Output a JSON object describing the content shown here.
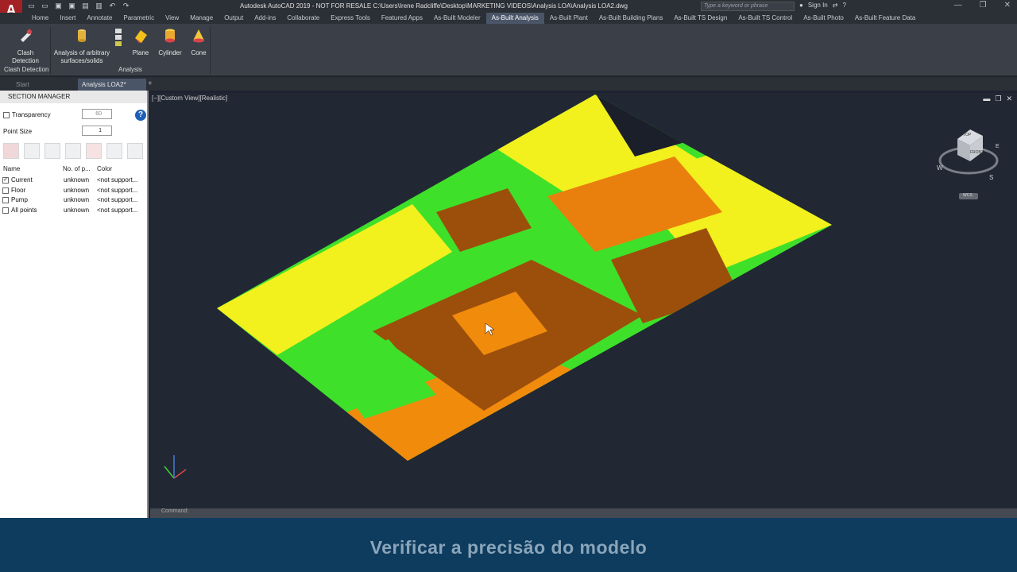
{
  "app": {
    "logo": "A",
    "title": "Autodesk AutoCAD 2019 - NOT FOR RESALE   C:\\Users\\Irene Radcliffe\\Desktop\\MARKETING VIDEOS\\Analysis LOA\\Analysis LOA2.dwg",
    "search_placeholder": "Type a keyword or phrase",
    "sign_in": "Sign In"
  },
  "menu_tabs": [
    "Home",
    "Insert",
    "Annotate",
    "Parametric",
    "View",
    "Manage",
    "Output",
    "Add-ins",
    "Collaborate",
    "Express Tools",
    "Featured Apps",
    "As-Built Modeler",
    "As-Built Analysis",
    "As-Built Plant",
    "As-Built Building Plans",
    "As-Built TS Design",
    "As-Built TS Control",
    "As-Built Photo",
    "As-Built Feature Data"
  ],
  "active_tab": "As-Built Analysis",
  "ribbon": {
    "clash_detection": "Clash Detection",
    "analysis_surfaces_l1": "Analysis of arbitrary",
    "analysis_surfaces_l2": "surfaces/solids",
    "plane": "Plane",
    "cylinder": "Cylinder",
    "cone": "Cone",
    "panel_clash": "Clash Detection",
    "panel_analysis": "Analysis"
  },
  "doc_tabs": {
    "start": "Start",
    "active": "Analysis LOA2*"
  },
  "section_manager": {
    "title": "SECTION MANAGER",
    "transparency_label": "Transparency",
    "transparency_value": "60",
    "point_size_label": "Point Size",
    "point_size_value": "1",
    "columns": {
      "name": "Name",
      "points": "No. of p...",
      "color": "Color"
    },
    "rows": [
      {
        "name": "Current",
        "points": "unknown",
        "color": "<not support...",
        "checked": true
      },
      {
        "name": "Floor",
        "points": "unknown",
        "color": "<not support...",
        "checked": false
      },
      {
        "name": "Pump",
        "points": "unknown",
        "color": "<not support...",
        "checked": false
      },
      {
        "name": "All points",
        "points": "unknown",
        "color": "<not support...",
        "checked": false
      }
    ]
  },
  "viewport": {
    "label": "[−][Custom View][Realistic]",
    "viewcube": {
      "top": "TOP",
      "front": "FRONT",
      "wcs": "WCS",
      "w": "W",
      "s": "S",
      "e": "E"
    }
  },
  "command_line": "Command:",
  "banner_text": "Verificar a precisão do modelo",
  "colors": {
    "green": "#3ee02a",
    "yellow": "#f4f21c",
    "orange": "#f08b0c",
    "brown": "#9c4f0a"
  }
}
